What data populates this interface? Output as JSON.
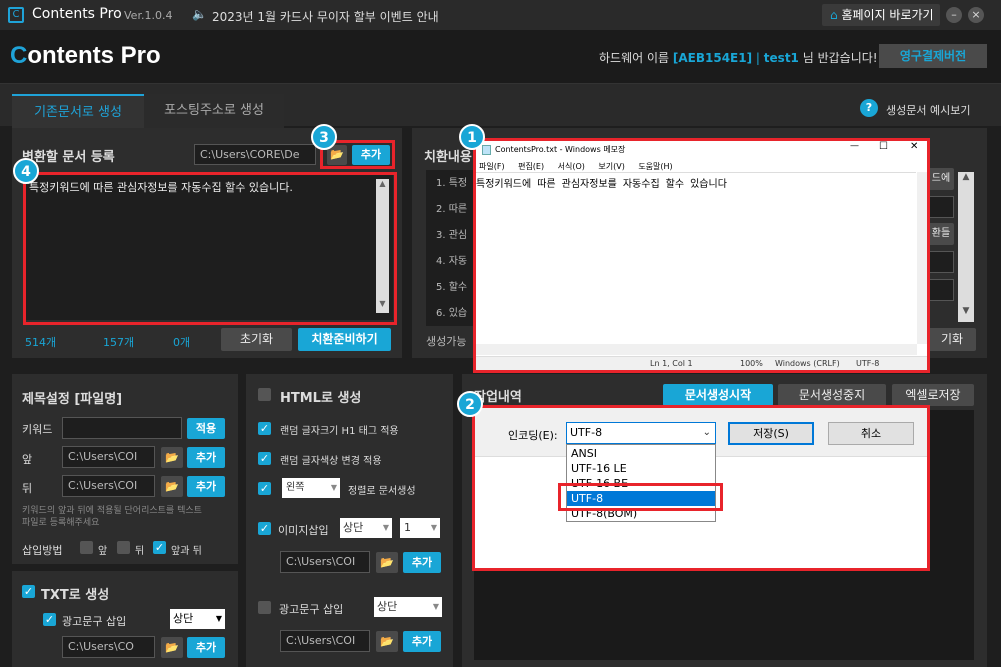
{
  "titlebar": {
    "app_name": "Contents Pro",
    "version": "Ver.1.0.4",
    "notice": "2023년 1월 카드사 무이자 할부 이벤트 안내",
    "home_link": "홈페이지 바로가기"
  },
  "header": {
    "logo_c": "C",
    "logo_rest": "ontents Pro",
    "greeting_prefix": "하드웨어 이름",
    "hw_id": "[AEB154E1]",
    "separator": "|",
    "user": "test1",
    "greeting_suffix": "님 반갑습니다!",
    "license_button": "영구결제버전"
  },
  "tabs": [
    {
      "label": "기존문서로 생성"
    },
    {
      "label": "포스팅주소로 생성"
    }
  ],
  "help": {
    "label": "생성문서 예시보기"
  },
  "register": {
    "title": "변환할 문서 등록",
    "path": "C:\\Users\\CORE\\De",
    "add": "추가",
    "content": "특정키워드에 따른 관심자정보를 자동수집 할수 있습니다.",
    "count1": "514개",
    "count2": "157개",
    "count3": "0개",
    "reset": "초기화",
    "prepare": "치환준비하기"
  },
  "replace": {
    "title": "치환내용",
    "lines": [
      "1. 특정",
      "2. 따른",
      "3. 관심",
      "4. 자동",
      "5. 할수",
      "6. 있습"
    ],
    "possible": "생성가능",
    "btn_partial_1": "드에",
    "btn_partial_2": "환들",
    "btn_partial_3": "기화"
  },
  "title_settings": {
    "title": "제목설정 [파일명]",
    "keyword_label": "키워드",
    "apply": "적용",
    "front_label": "앞",
    "front_path": "C:\\Users\\COI",
    "back_label": "뒤",
    "back_path": "C:\\Users\\COI",
    "add": "추가",
    "hint": "키워드의 앞과 뒤에 적용될 단어리스트를 텍스트 파일로 등록해주세요",
    "insert_label": "삽입방법",
    "opt_front": "앞",
    "opt_back": "뒤",
    "opt_both": "앞과 뒤"
  },
  "txt": {
    "title": "TXT로 생성",
    "ad_label": "광고문구 삽입",
    "position": "상단",
    "path": "C:\\Users\\CO",
    "add": "추가"
  },
  "html": {
    "title": "HTML로 생성",
    "opt1": "랜덤 글자크기 H1 태그 적용",
    "opt2": "랜덤 글자색상 변경 적용",
    "align": "왼쪽",
    "align_label": "정렬로 문서생성",
    "image_label": "이미지삽입",
    "image_pos": "상단",
    "image_count": "1",
    "path": "C:\\Users\\COI",
    "add": "추가",
    "ad_label": "광고문구 삽입",
    "ad_pos": "상단",
    "ad_path": "C:\\Users\\COI",
    "ad_add": "추가"
  },
  "work": {
    "title": "작업내역",
    "start": "문서생성시작",
    "stop": "문서생성중지",
    "excel": "엑셀로저장"
  },
  "notepad": {
    "title": "ContentsPro.txt - Windows 메모장",
    "menu": [
      "파일(F)",
      "편집(E)",
      "서식(O)",
      "보기(V)",
      "도움말(H)"
    ],
    "content": "특정키워드에 따른 관심자정보를 자동수집 할수 있습니다",
    "status_pos": "Ln 1, Col 1",
    "zoom": "100%",
    "eol": "Windows (CRLF)",
    "encoding": "UTF-8",
    "minimize": "—",
    "maximize": "☐",
    "close": "✕"
  },
  "save_dialog": {
    "encoding_label": "인코딩(E):",
    "selected": "UTF-8",
    "save": "저장(S)",
    "cancel": "취소",
    "options": [
      "ANSI",
      "UTF-16 LE",
      "UTF-16 BE",
      "UTF-8",
      "UTF-8(BOM)"
    ]
  },
  "badges": [
    "1",
    "2",
    "3",
    "4"
  ],
  "colors": {
    "accent": "#19a6d6",
    "highlight": "#e8242b"
  }
}
